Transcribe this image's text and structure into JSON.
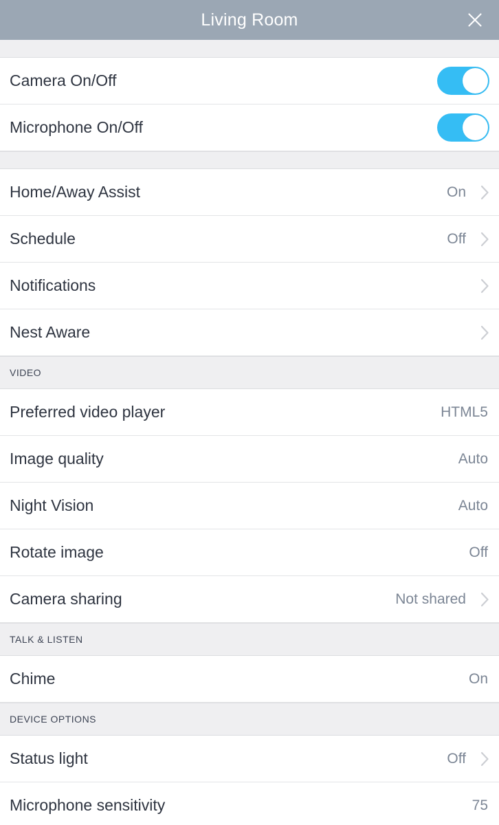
{
  "header": {
    "title": "Living Room",
    "close_icon": "close-icon"
  },
  "sections": [
    {
      "id": "toggles",
      "label": "",
      "rows": [
        {
          "label": "Camera On/Off",
          "type": "toggle",
          "state": "on"
        },
        {
          "label": "Microphone On/Off",
          "type": "toggle",
          "state": "on"
        }
      ]
    },
    {
      "id": "general",
      "label": "",
      "rows": [
        {
          "label": "Home/Away Assist",
          "type": "nav",
          "value": "On",
          "chevron": true
        },
        {
          "label": "Schedule",
          "type": "nav",
          "value": "Off",
          "chevron": true
        },
        {
          "label": "Notifications",
          "type": "nav",
          "value": "",
          "chevron": true
        },
        {
          "label": "Nest Aware",
          "type": "nav",
          "value": "",
          "chevron": true
        }
      ]
    },
    {
      "id": "video",
      "label": "VIDEO",
      "rows": [
        {
          "label": "Preferred video player",
          "type": "value",
          "value": "HTML5",
          "chevron": false
        },
        {
          "label": "Image quality",
          "type": "value",
          "value": "Auto",
          "chevron": false
        },
        {
          "label": "Night Vision",
          "type": "value",
          "value": "Auto",
          "chevron": false
        },
        {
          "label": "Rotate image",
          "type": "value",
          "value": "Off",
          "chevron": false
        },
        {
          "label": "Camera sharing",
          "type": "nav",
          "value": "Not shared",
          "chevron": true
        }
      ]
    },
    {
      "id": "talk-listen",
      "label": "TALK & LISTEN",
      "rows": [
        {
          "label": "Chime",
          "type": "value",
          "value": "On",
          "chevron": false
        }
      ]
    },
    {
      "id": "device-options",
      "label": "DEVICE OPTIONS",
      "rows": [
        {
          "label": "Status light",
          "type": "nav",
          "value": "Off",
          "chevron": true
        },
        {
          "label": "Microphone sensitivity",
          "type": "value",
          "value": "75",
          "chevron": false
        }
      ]
    }
  ],
  "colors": {
    "header_bg": "#9BA7B4",
    "toggle_on": "#35BDF4",
    "row_label": "#2E3440",
    "row_value": "#7B8594",
    "section_bg": "#EFEFF1",
    "divider": "#E3E4E6"
  }
}
